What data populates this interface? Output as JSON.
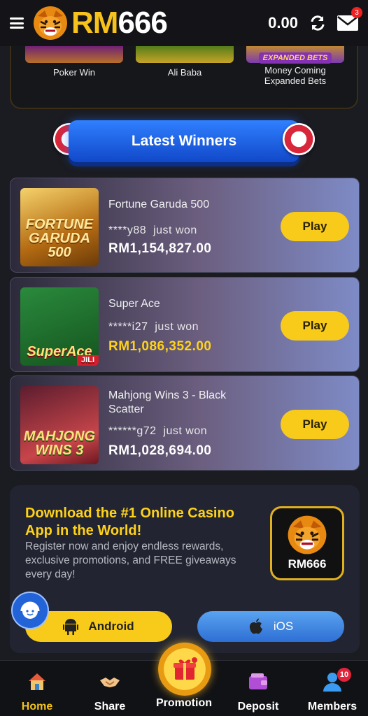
{
  "header": {
    "logo_text_rm": "RM",
    "logo_text_num": "666",
    "balance": "0.00",
    "mail_badge": "3"
  },
  "top_games": [
    {
      "name": "Poker Win"
    },
    {
      "name": "Ali Baba"
    },
    {
      "name": "Money Coming Expanded Bets",
      "tag": "EXPANDED BETS"
    }
  ],
  "latest_winners": {
    "title": "Latest Winners",
    "items": [
      {
        "game": "Fortune Garuda 500",
        "thumb_text": "FORTUNE GARUDA 500",
        "user": "****y88",
        "action": "just won",
        "amount": "RM1,154,827.00",
        "play": "Play"
      },
      {
        "game": "Super Ace",
        "thumb_text": "SuperAce",
        "provider": "JILI",
        "user": "*****i27",
        "action": "just won",
        "amount": "RM1,086,352.00",
        "play": "Play"
      },
      {
        "game": "Mahjong Wins 3 - Black Scatter",
        "thumb_text": "MAHJONG WINS 3",
        "user": "******g72",
        "action": "just won",
        "amount": "RM1,028,694.00",
        "play": "Play"
      }
    ]
  },
  "download": {
    "title": "Download the #1 Online Casino App in the World!",
    "description": "Register now and enjoy endless rewards, exclusive promotions, and FREE giveaways every day!",
    "app_name": "RM666",
    "android_label": "Android",
    "ios_label": "iOS"
  },
  "bottom_nav": {
    "home": "Home",
    "share": "Share",
    "promotion": "Promotion",
    "deposit": "Deposit",
    "members": "Members",
    "members_badge": "10"
  },
  "colors": {
    "accent": "#f8cb1b",
    "banner_blue": "#1e5fe0",
    "background": "#1b1c21"
  }
}
